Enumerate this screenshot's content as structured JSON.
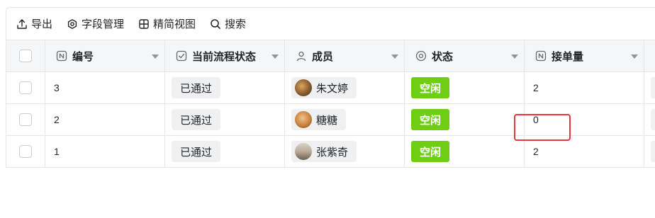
{
  "toolbar": {
    "export_label": "导出",
    "fields_label": "字段管理",
    "view_label": "精简视图",
    "search_label": "搜索"
  },
  "table": {
    "headers": {
      "number": "编号",
      "flow_status": "当前流程状态",
      "member": "成员",
      "status": "状态",
      "orders": "接单量"
    },
    "rows": [
      {
        "number": "3",
        "flow_status": "已通过",
        "member": "朱文婷",
        "status": "空闲",
        "orders": "2"
      },
      {
        "number": "2",
        "flow_status": "已通过",
        "member": "糖糖",
        "status": "空闲",
        "orders": "0"
      },
      {
        "number": "1",
        "flow_status": "已通过",
        "member": "张紫奇",
        "status": "空闲",
        "orders": "2"
      }
    ]
  },
  "colors": {
    "status_green": "#6fcd14",
    "highlight_red": "#e8343a",
    "header_bg": "#f5f6f7"
  }
}
